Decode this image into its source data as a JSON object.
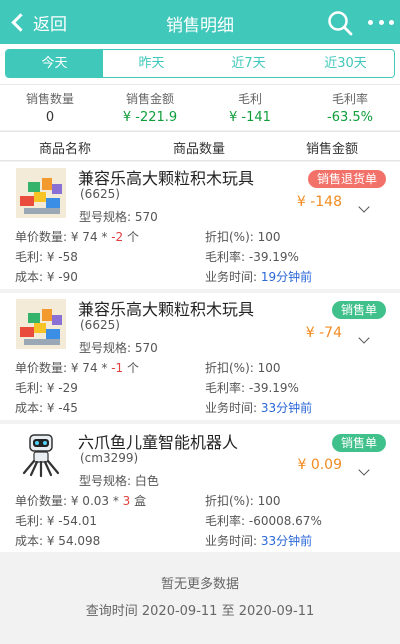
{
  "header": {
    "back_label": "返回",
    "title": "销售明细",
    "search_icon": "search-icon",
    "more_icon": "more-icon"
  },
  "tabs": [
    {
      "label": "今天",
      "active": true
    },
    {
      "label": "昨天",
      "active": false
    },
    {
      "label": "近7天",
      "active": false
    },
    {
      "label": "近30天",
      "active": false
    }
  ],
  "summary": {
    "qty_label": "销售数量",
    "qty_value": "0",
    "amount_label": "销售金额",
    "amount_value": "¥ -221.9",
    "profit_label": "毛利",
    "profit_value": "¥ -141",
    "rate_label": "毛利率",
    "rate_value": "-63.5%"
  },
  "columns": {
    "name": "商品名称",
    "qty": "商品数量",
    "amount": "销售金额"
  },
  "items": [
    {
      "name": "兼容乐高大颗粒积木玩具",
      "code": "(6625)",
      "spec": "型号规格: 570",
      "badge": "销售退货单",
      "amount": "¥ -148",
      "unit_label": "单价数量: ¥ 74 * ",
      "unit_qty": "-2",
      "unit_suffix": " 个",
      "discount": "折扣(%): 100",
      "profit": "毛利: ¥ -58",
      "rate": "毛利率: -39.19%",
      "cost": "成本: ¥ -90",
      "time_label": "业务时间: ",
      "time_value": "19分钟前"
    },
    {
      "name": "兼容乐高大颗粒积木玩具",
      "code": "(6625)",
      "spec": "型号规格: 570",
      "badge": "销售单",
      "amount": "¥ -74",
      "unit_label": "单价数量: ¥ 74 * ",
      "unit_qty": "-1",
      "unit_suffix": " 个",
      "discount": "折扣(%): 100",
      "profit": "毛利: ¥ -29",
      "rate": "毛利率: -39.19%",
      "cost": "成本: ¥ -45",
      "time_label": "业务时间: ",
      "time_value": "33分钟前"
    },
    {
      "name": "六爪鱼儿童智能机器人",
      "code": "(cm3299)",
      "spec": "型号规格: 白色",
      "badge": "销售单",
      "amount": "¥ 0.09",
      "unit_label": "单价数量: ¥ 0.03 * ",
      "unit_qty": "3",
      "unit_suffix": " 盒",
      "discount": "折扣(%): 100",
      "profit": "毛利: ¥ -54.01",
      "rate": "毛利率: -60008.67%",
      "cost": "成本: ¥ 54.098",
      "time_label": "业务时间: ",
      "time_value": "33分钟前"
    }
  ],
  "footer": {
    "no_more": "暂无更多数据",
    "query_time": "查询时间 2020-09-11 至 2020-09-11"
  },
  "colors": {
    "primary": "#40c8bb",
    "green": "#0f9d3a",
    "orange": "#f28b22",
    "red": "#e04040",
    "blue": "#2a67d8",
    "badge_return": "#f2726a",
    "badge_sale": "#40c08a"
  }
}
